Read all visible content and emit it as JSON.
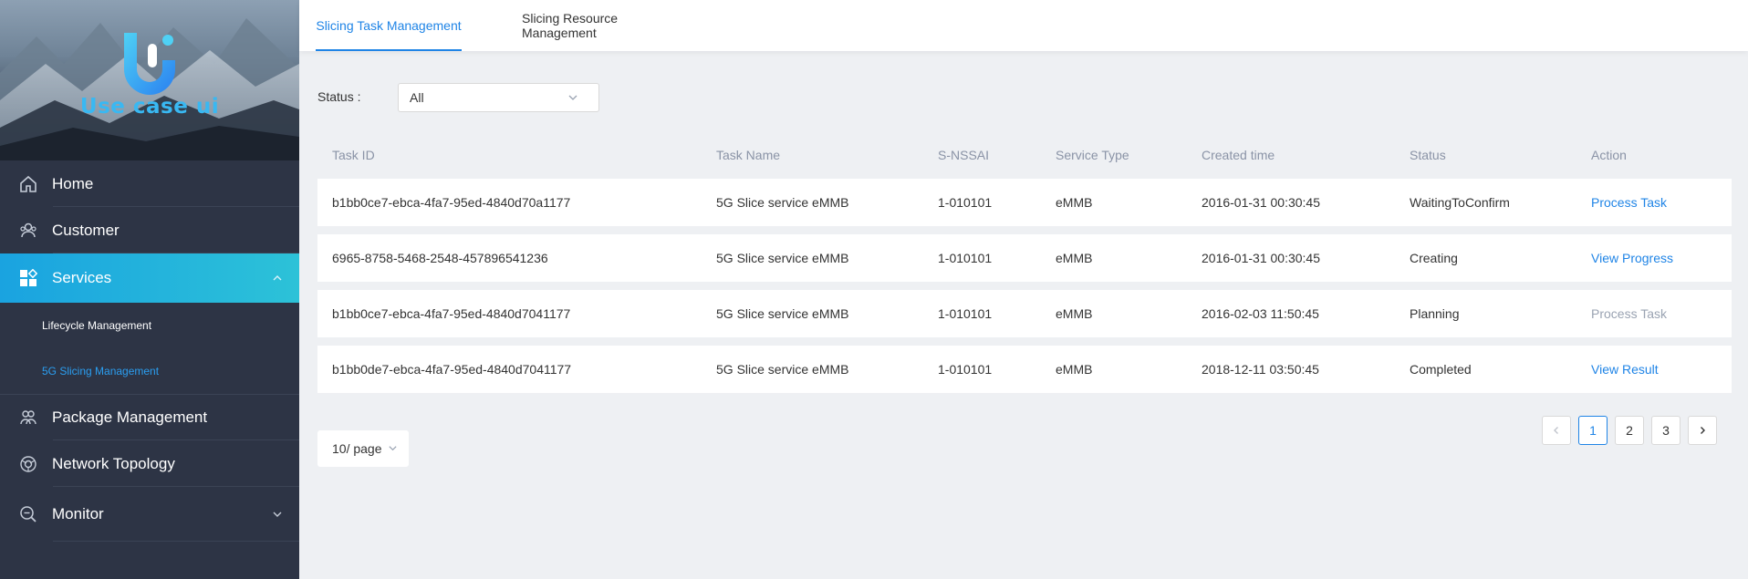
{
  "sidebar": {
    "brand_name": "Use case ui",
    "menu": [
      {
        "label": "Home",
        "icon": "home-icon"
      },
      {
        "label": "Customer",
        "icon": "customer-icon"
      },
      {
        "label": "Services",
        "icon": "services-icon",
        "expanded": true
      },
      {
        "label": "Package Management",
        "icon": "package-icon"
      },
      {
        "label": "Network Topology",
        "icon": "network-topology-icon"
      },
      {
        "label": "Monitor",
        "icon": "monitor-icon"
      }
    ],
    "submenu": [
      {
        "label": "Lifecycle Management"
      },
      {
        "label": "5G Slicing Management",
        "selected": true
      }
    ]
  },
  "tabs": [
    {
      "label": "Slicing Task Management",
      "active": true
    },
    {
      "label": "Slicing Resource Management"
    }
  ],
  "filter": {
    "label": "Status :",
    "value": "All"
  },
  "table": {
    "columns": [
      "Task ID",
      "Task Name",
      "S-NSSAI",
      "Service Type",
      "Created time",
      "Status",
      "Action"
    ],
    "rows": [
      {
        "task_id": "b1bb0ce7-ebca-4fa7-95ed-4840d70a1177",
        "task_name": "5G Slice service eMMB",
        "snssai": "1-010101",
        "service_type": "eMMB",
        "created": "2016-01-31 00:30:45",
        "status": "WaitingToConfirm",
        "action": "Process Task",
        "action_enabled": true
      },
      {
        "task_id": "6965-8758-5468-2548-457896541236",
        "task_name": "5G Slice service eMMB",
        "snssai": "1-010101",
        "service_type": "eMMB",
        "created": "2016-01-31 00:30:45",
        "status": "Creating",
        "action": "View Progress",
        "action_enabled": true
      },
      {
        "task_id": "b1bb0ce7-ebca-4fa7-95ed-4840d7041177",
        "task_name": "5G Slice service eMMB",
        "snssai": "1-010101",
        "service_type": "eMMB",
        "created": "2016-02-03 11:50:45",
        "status": "Planning",
        "action": "Process Task",
        "action_enabled": false
      },
      {
        "task_id": "b1bb0de7-ebca-4fa7-95ed-4840d7041177",
        "task_name": "5G Slice service eMMB",
        "snssai": "1-010101",
        "service_type": "eMMB",
        "created": "2018-12-11 03:50:45",
        "status": "Completed",
        "action": "View Result",
        "action_enabled": true
      }
    ]
  },
  "pagination": {
    "page_size_label": "10/ page",
    "pages": [
      "1",
      "2",
      "3"
    ],
    "current": "1"
  },
  "colors": {
    "accent": "#1f84e6",
    "sidebar_bg": "#2d3445",
    "active_menu_from": "#1aa3e0",
    "active_menu_to": "#2cc2d8",
    "disabled_text": "#9aa3b2"
  }
}
